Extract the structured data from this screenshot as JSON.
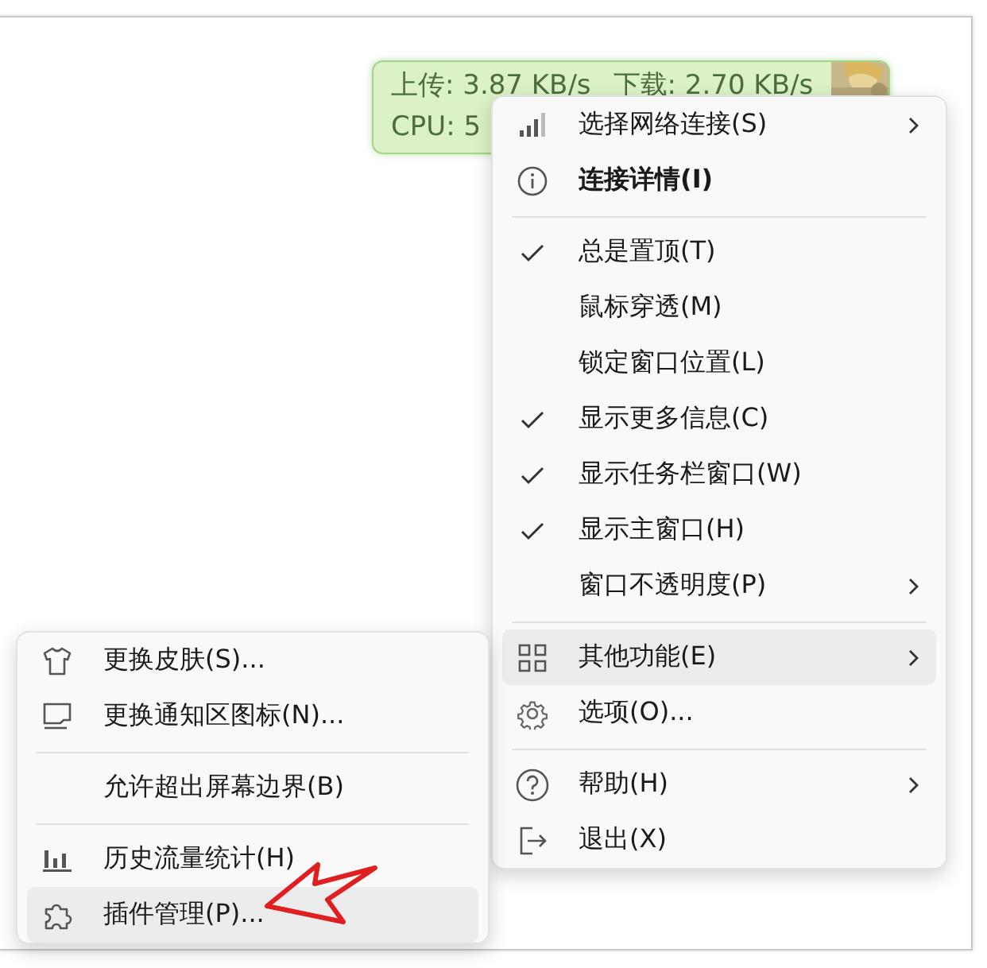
{
  "widget": {
    "upload": "上传: 3.87 KB/s",
    "download": "下载: 2.70 KB/s",
    "cpu": "CPU: 5"
  },
  "main_menu": {
    "items": [
      {
        "kind": "item",
        "label": "选择网络连接(S)",
        "checked": false,
        "bold": false,
        "submenu": true,
        "highlighted": false
      },
      {
        "kind": "item",
        "label": "连接详情(I)",
        "checked": false,
        "bold": true,
        "submenu": false,
        "highlighted": false
      },
      {
        "kind": "separator"
      },
      {
        "kind": "item",
        "label": "总是置顶(T)",
        "checked": true,
        "bold": false,
        "submenu": false,
        "highlighted": false
      },
      {
        "kind": "item",
        "label": "鼠标穿透(M)",
        "checked": false,
        "bold": false,
        "submenu": false,
        "highlighted": false
      },
      {
        "kind": "item",
        "label": "锁定窗口位置(L)",
        "checked": false,
        "bold": false,
        "submenu": false,
        "highlighted": false
      },
      {
        "kind": "item",
        "label": "显示更多信息(C)",
        "checked": true,
        "bold": false,
        "submenu": false,
        "highlighted": false
      },
      {
        "kind": "item",
        "label": "显示任务栏窗口(W)",
        "checked": true,
        "bold": false,
        "submenu": false,
        "highlighted": false
      },
      {
        "kind": "item",
        "label": "显示主窗口(H)",
        "checked": true,
        "bold": false,
        "submenu": false,
        "highlighted": false
      },
      {
        "kind": "item",
        "label": "窗口不透明度(P)",
        "checked": false,
        "bold": false,
        "submenu": true,
        "highlighted": false
      },
      {
        "kind": "separator"
      },
      {
        "kind": "item",
        "label": "其他功能(E)",
        "checked": false,
        "bold": false,
        "submenu": true,
        "highlighted": true
      },
      {
        "kind": "item",
        "label": "选项(O)...",
        "checked": false,
        "bold": false,
        "submenu": false,
        "highlighted": false
      },
      {
        "kind": "separator"
      },
      {
        "kind": "item",
        "label": "帮助(H)",
        "checked": false,
        "bold": false,
        "submenu": true,
        "highlighted": false
      },
      {
        "kind": "item",
        "label": "退出(X)",
        "checked": false,
        "bold": false,
        "submenu": false,
        "highlighted": false
      }
    ]
  },
  "sub_menu": {
    "items": [
      {
        "kind": "item",
        "label": "更换皮肤(S)...",
        "highlighted": false
      },
      {
        "kind": "item",
        "label": "更换通知区图标(N)...",
        "highlighted": false
      },
      {
        "kind": "separator"
      },
      {
        "kind": "item",
        "label": "允许超出屏幕边界(B)",
        "highlighted": false
      },
      {
        "kind": "separator"
      },
      {
        "kind": "item",
        "label": "历史流量统计(H)",
        "highlighted": false
      },
      {
        "kind": "item",
        "label": "插件管理(P)...",
        "highlighted": true
      }
    ]
  }
}
